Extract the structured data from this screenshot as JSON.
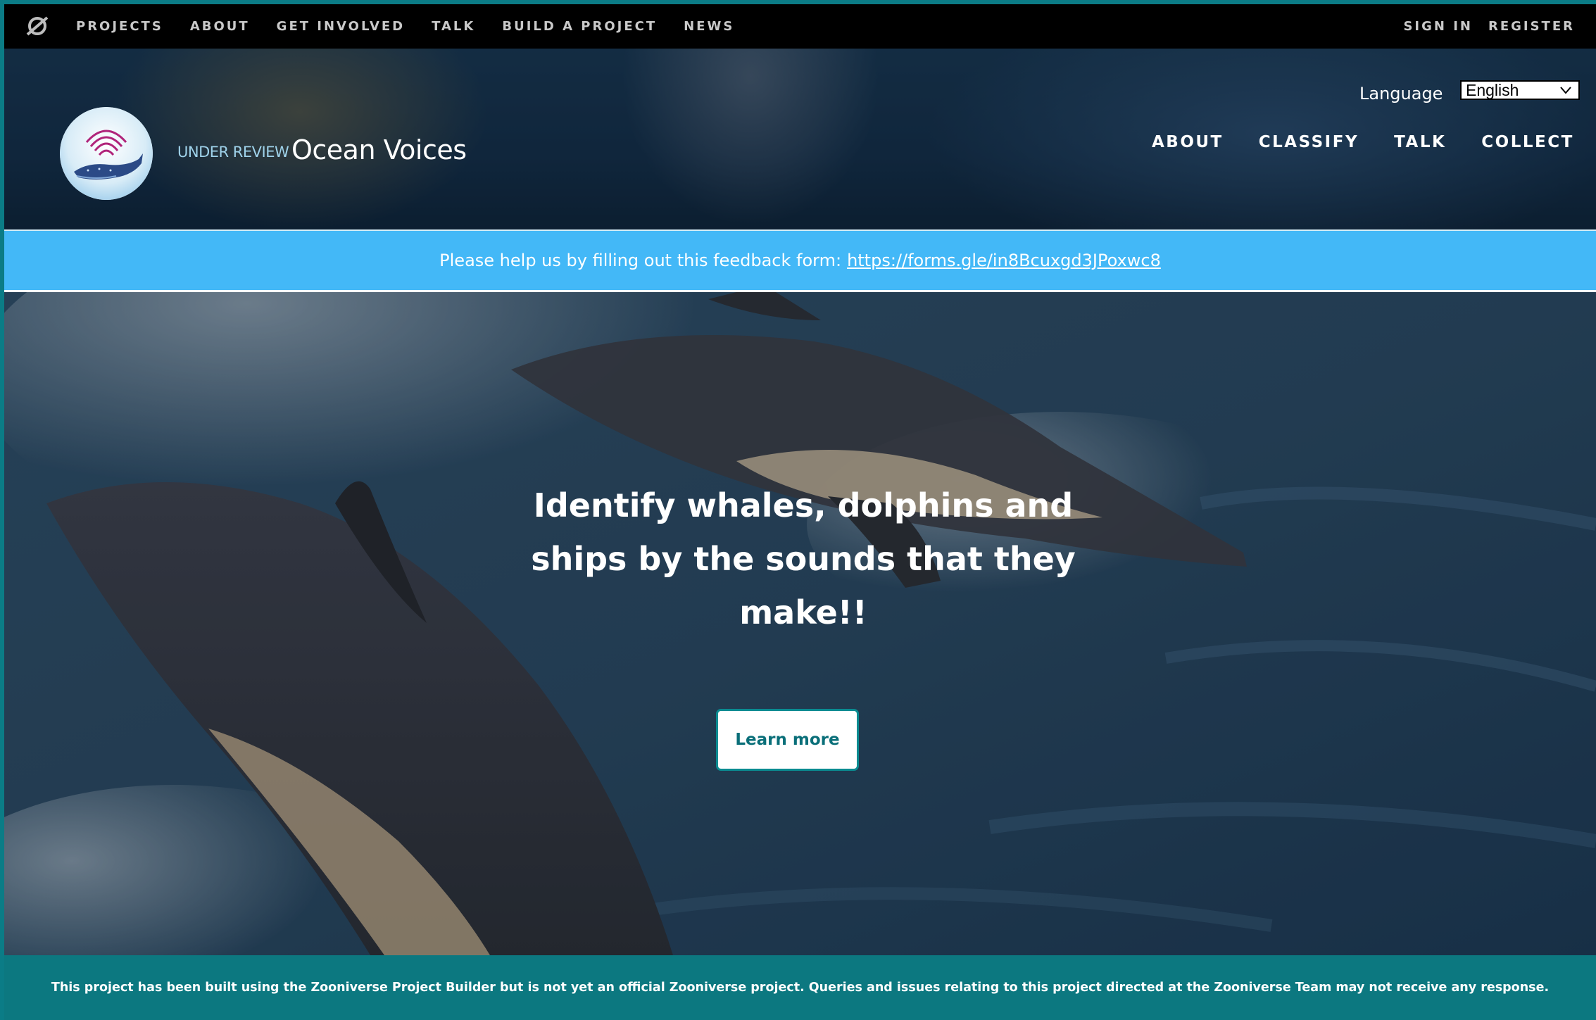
{
  "topnav": {
    "logo_icon": "zooniverse-logo-icon",
    "links": [
      "PROJECTS",
      "ABOUT",
      "GET INVOLVED",
      "TALK",
      "BUILD A PROJECT",
      "NEWS"
    ],
    "sign_in": "SIGN IN",
    "register": "REGISTER"
  },
  "header": {
    "avatar_icon": "whale-avatar-icon",
    "review_tag": "UNDER REVIEW",
    "title": "Ocean Voices",
    "language_label": "Language",
    "language_value": "English",
    "nav": [
      "ABOUT",
      "CLASSIFY",
      "TALK",
      "COLLECT"
    ]
  },
  "banner": {
    "text": "Please help us by filling out this feedback form:",
    "link": "https://forms.gle/in8Bcuxgd3JPoxwc8",
    "color": "#43b8f7"
  },
  "hero": {
    "headline": "Identify whales, dolphins and ships by the sounds that they make!!",
    "button": "Learn more"
  },
  "notice": {
    "text": "This project has been built using the Zooniverse Project Builder but is not yet an official Zooniverse project. Queries and issues relating to this project directed at the Zooniverse Team may not receive any response.",
    "color": "#0c7880"
  }
}
